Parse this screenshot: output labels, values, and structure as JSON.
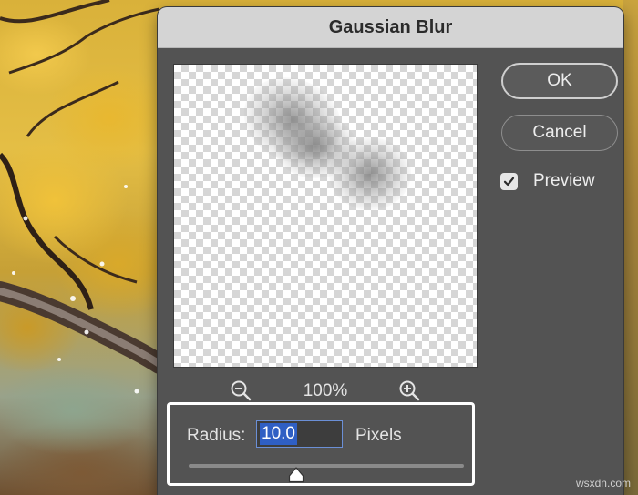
{
  "dialog": {
    "title": "Gaussian Blur",
    "ok_label": "OK",
    "cancel_label": "Cancel",
    "preview_label": "Preview",
    "preview_checked": true
  },
  "zoom": {
    "level": "100%",
    "zoom_out_icon": "zoom-out-icon",
    "zoom_in_icon": "zoom-in-icon"
  },
  "radius": {
    "label": "Radius:",
    "value": "10.0",
    "units": "Pixels",
    "slider_fraction": 0.39
  },
  "watermark": "wsxdn.com",
  "colors": {
    "dialog_bg": "#535353",
    "titlebar_bg": "#d4d4d4",
    "selection_highlight": "#2f5fc4",
    "focus_border": "#6b8fd6"
  }
}
